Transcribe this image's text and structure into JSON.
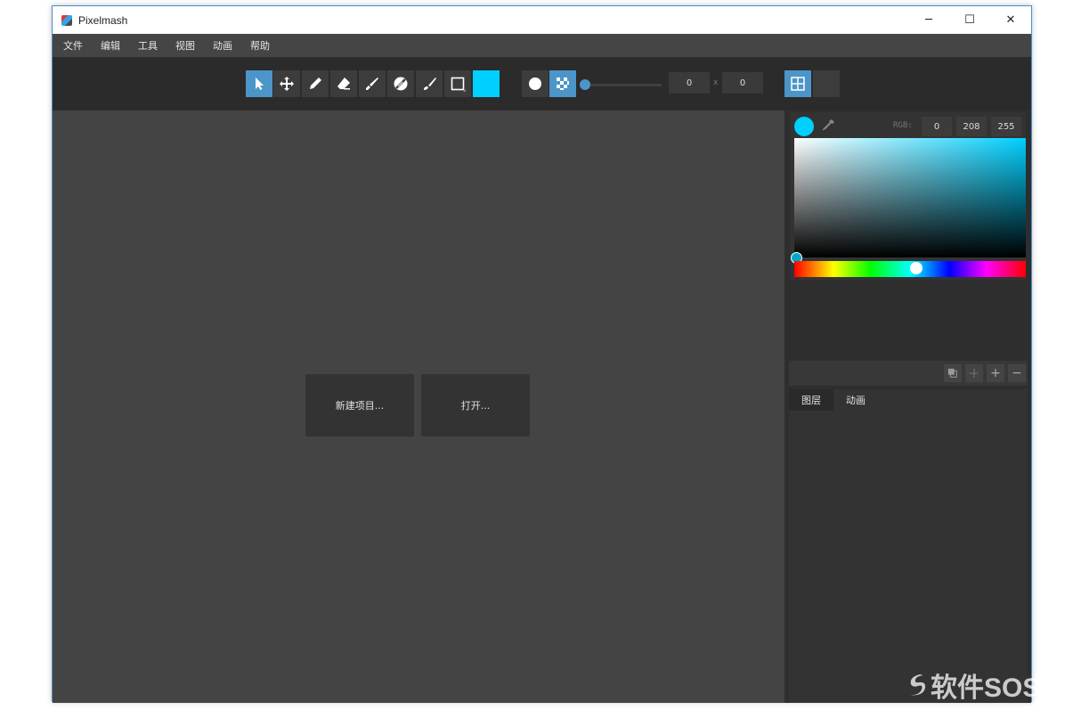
{
  "window": {
    "title": "Pixelmash"
  },
  "window_controls": {
    "minimize": "─",
    "maximize": "☐",
    "close": "✕"
  },
  "menu": [
    "文件",
    "编辑",
    "工具",
    "视图",
    "动画",
    "帮助"
  ],
  "toolbar": {
    "tools": [
      "select-icon",
      "move-icon",
      "pencil-icon",
      "eraser-icon",
      "brush-icon",
      "fill-icon",
      "paint-brush-icon",
      "rectangle-icon"
    ],
    "active_tool": "select-icon",
    "primary_color": "#00d0ff",
    "accent": "#4b95c9",
    "brush_shape": "circle-icon",
    "pattern": "checker-icon",
    "slider_value": 0,
    "width_value": "0",
    "separator": "x",
    "height_value": "0"
  },
  "start": {
    "new_project": "新建项目...",
    "open": "打开..."
  },
  "color_picker": {
    "rgb_label": "RGB:",
    "r": "0",
    "g": "208",
    "b": "255",
    "current": "#00d0ff"
  },
  "layers": {
    "tools": [
      "duplicate-icon",
      "move-layer-icon",
      "+",
      "−"
    ],
    "tabs": [
      "图层",
      "动画"
    ]
  },
  "watermark": "软件SOS"
}
